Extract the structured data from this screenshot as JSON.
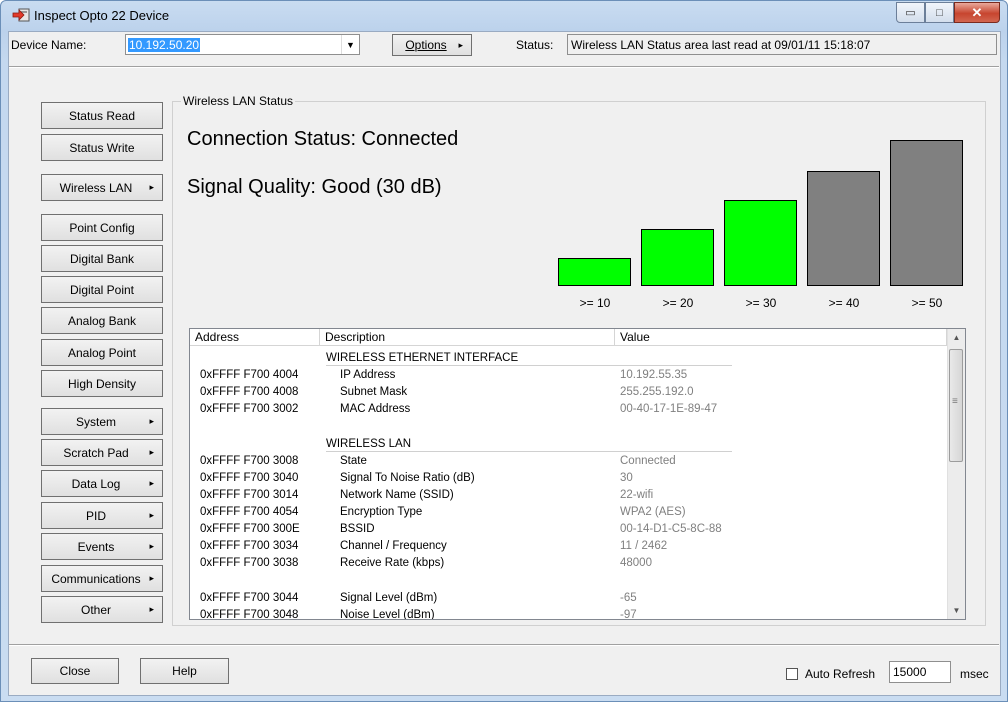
{
  "window": {
    "title": "Inspect Opto 22 Device",
    "minimize_icon": "minimize-icon",
    "maximize_icon": "maximize-icon",
    "close_icon": "close-icon",
    "minimize_glyph": "▭",
    "maximize_glyph": "□",
    "close_glyph": "✕"
  },
  "toolbar": {
    "device_name_label": "Device Name:",
    "device_name_value": "10.192.50.20",
    "dropdown_glyph": "▼",
    "options_label": "Options",
    "arrow_glyph": "▸",
    "status_label": "Status:",
    "status_value": "Wireless LAN Status area last read at 09/01/11 15:18:07"
  },
  "sidebar": {
    "items": [
      {
        "label": "Status Read",
        "submenu": false
      },
      {
        "label": "Status Write",
        "submenu": false
      },
      {
        "label": "Wireless LAN",
        "submenu": true
      },
      {
        "label": "Point Config",
        "submenu": false
      },
      {
        "label": "Digital Bank",
        "submenu": false
      },
      {
        "label": "Digital Point",
        "submenu": false
      },
      {
        "label": "Analog Bank",
        "submenu": false
      },
      {
        "label": "Analog Point",
        "submenu": false
      },
      {
        "label": "High Density",
        "submenu": false
      },
      {
        "label": "System",
        "submenu": true
      },
      {
        "label": "Scratch Pad",
        "submenu": true
      },
      {
        "label": "Data Log",
        "submenu": true
      },
      {
        "label": "PID",
        "submenu": true
      },
      {
        "label": "Events",
        "submenu": true
      },
      {
        "label": "Communications",
        "submenu": true
      },
      {
        "label": "Other",
        "submenu": true
      }
    ]
  },
  "panel": {
    "group_title": "Wireless LAN Status",
    "connection_status": "Connection Status:  Connected",
    "signal_quality": "Signal Quality:  Good  (30 dB)"
  },
  "signal_bars": {
    "colors": {
      "active": "#00ff00",
      "inactive": "#808080"
    },
    "bars": [
      {
        "label": ">= 10",
        "active": true
      },
      {
        "label": ">= 20",
        "active": true
      },
      {
        "label": ">= 30",
        "active": true
      },
      {
        "label": ">= 40",
        "active": false
      },
      {
        "label": ">= 50",
        "active": false
      }
    ]
  },
  "table": {
    "headers": [
      "Address",
      "Description",
      "Value"
    ],
    "rows": [
      {
        "type": "section",
        "desc": "WIRELESS ETHERNET INTERFACE"
      },
      {
        "type": "data",
        "addr": "0xFFFF F700 4004",
        "desc": "IP Address",
        "val": "10.192.55.35"
      },
      {
        "type": "data",
        "addr": "0xFFFF F700 4008",
        "desc": "Subnet Mask",
        "val": "255.255.192.0"
      },
      {
        "type": "data",
        "addr": "0xFFFF F700 3002",
        "desc": "MAC Address",
        "val": "00-40-17-1E-89-47"
      },
      {
        "type": "blank"
      },
      {
        "type": "section",
        "desc": "WIRELESS LAN"
      },
      {
        "type": "data",
        "addr": "0xFFFF F700 3008",
        "desc": "State",
        "val": "Connected"
      },
      {
        "type": "data",
        "addr": "0xFFFF F700 3040",
        "desc": "Signal To Noise Ratio (dB)",
        "val": "30"
      },
      {
        "type": "data",
        "addr": "0xFFFF F700 3014",
        "desc": "Network Name (SSID)",
        "val": "22-wifi"
      },
      {
        "type": "data",
        "addr": "0xFFFF F700 4054",
        "desc": "Encryption Type",
        "val": "WPA2 (AES)"
      },
      {
        "type": "data",
        "addr": "0xFFFF F700 300E",
        "desc": "BSSID",
        "val": "00-14-D1-C5-8C-88"
      },
      {
        "type": "data",
        "addr": "0xFFFF F700 3034",
        "desc": "Channel / Frequency",
        "val": "11 / 2462"
      },
      {
        "type": "data",
        "addr": "0xFFFF F700 3038",
        "desc": "Receive Rate (kbps)",
        "val": "48000"
      },
      {
        "type": "blank"
      },
      {
        "type": "data",
        "addr": "0xFFFF F700 3044",
        "desc": "Signal Level (dBm)",
        "val": "-65"
      },
      {
        "type": "data",
        "addr": "0xFFFF F700 3048",
        "desc": "Noise Level (dBm)",
        "val": "-97"
      }
    ],
    "scroll_up_glyph": "▲",
    "scroll_down_glyph": "▼",
    "thumb_grip_glyph": "≡"
  },
  "footer": {
    "close_label": "Close",
    "help_label": "Help",
    "auto_refresh_label": "Auto Refresh",
    "auto_refresh_checked": false,
    "refresh_interval": "15000",
    "unit_label": "msec"
  }
}
